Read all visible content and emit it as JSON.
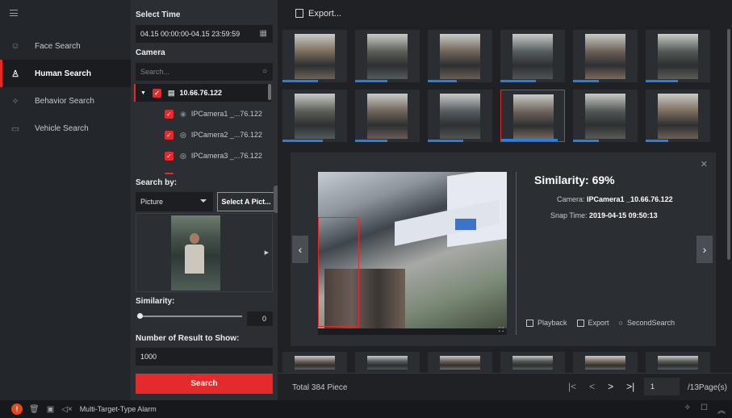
{
  "sidebar": {
    "items": [
      {
        "label": "Face Search",
        "icon": "face-search-icon",
        "active": false
      },
      {
        "label": "Human Search",
        "icon": "human-search-icon",
        "active": true
      },
      {
        "label": "Behavior Search",
        "icon": "behavior-search-icon",
        "active": false
      },
      {
        "label": "Vehicle Search",
        "icon": "vehicle-search-icon",
        "active": false
      }
    ]
  },
  "panel": {
    "select_time_label": "Select Time",
    "time_range": "04.15 00:00:00-04.15 23:59:59",
    "camera_label": "Camera",
    "camera_search_placeholder": "Search...",
    "tree": {
      "root": "10.66.76.122",
      "cameras": [
        {
          "name": "IPCamera1 _...76.122"
        },
        {
          "name": "IPCamera2 _...76.122"
        },
        {
          "name": "IPCamera3 _...76.122"
        }
      ]
    },
    "search_by_label": "Search by:",
    "search_by_value": "Picture",
    "select_picture_button": "Select A Pict...",
    "similarity_label": "Similarity:",
    "similarity_value": "0",
    "result_count_label": "Number of Result to Show:",
    "result_count_value": "1000",
    "search_button": "Search"
  },
  "main": {
    "export_label": "Export...",
    "detail": {
      "similarity_label": "Similarity:",
      "similarity_value": "69%",
      "camera_key": "Camera:",
      "camera_value": "IPCamera1 _10.66.76.122",
      "snap_key": "Snap Time:",
      "snap_value": "2019-04-15 09:50:13",
      "actions": {
        "playback": "Playback",
        "export": "Export",
        "second_search": "SecondSearch"
      }
    },
    "footer": {
      "total": "Total 384 Piece",
      "page_input": "1",
      "page_total": "/13Page(s)"
    }
  },
  "statusbar": {
    "alarm_text": "Multi-Target-Type Alarm"
  },
  "colors": {
    "accent": "#e42a2a",
    "progress": "#2a7de1",
    "background": "#1f2125",
    "panel": "#2b2e33"
  }
}
